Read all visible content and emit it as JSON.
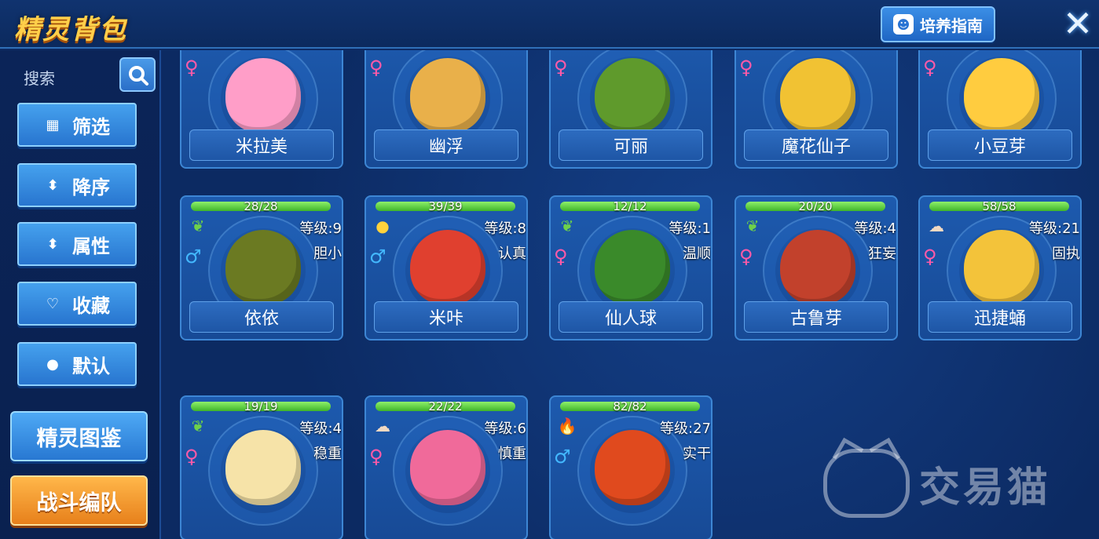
{
  "header": {
    "title": "精灵背包",
    "guide_label": "培养指南",
    "close_glyph": "✕"
  },
  "sidebar": {
    "search_label": "搜索",
    "buttons": [
      {
        "label": "筛选",
        "icon": "grid-icon"
      },
      {
        "label": "降序",
        "icon": "sort-icon"
      },
      {
        "label": "属性",
        "icon": "attribute-icon"
      },
      {
        "label": "收藏",
        "icon": "heart-icon"
      },
      {
        "label": "默认",
        "icon": "default-icon"
      }
    ],
    "dex_label": "精灵图鉴",
    "team_label": "战斗编队"
  },
  "pets": [
    {
      "name": "米拉美",
      "gender": "♀",
      "color": "#ff9ec8"
    },
    {
      "name": "幽浮",
      "gender": "♀",
      "color": "#e9b04a"
    },
    {
      "name": "可丽",
      "gender": "♀",
      "color": "#5f9a2c"
    },
    {
      "name": "魔花仙子",
      "gender": "♀",
      "color": "#f1c233"
    },
    {
      "name": "小豆芽",
      "gender": "♀",
      "color": "#ffcc3f"
    },
    {
      "name": "依依",
      "gender": "♂",
      "color": "#6b7a22",
      "hp": "28/28",
      "hp_ratio": 1.0,
      "level": "等级:9",
      "nature": "胆小",
      "attr": "grass"
    },
    {
      "name": "米咔",
      "gender": "♂",
      "color": "#e0402f",
      "hp": "39/39",
      "hp_ratio": 1.0,
      "level": "等级:8",
      "nature": "认真",
      "attr": "electric"
    },
    {
      "name": "仙人球",
      "gender": "♀",
      "color": "#3a8a2a",
      "hp": "12/12",
      "hp_ratio": 1.0,
      "level": "等级:1",
      "nature": "温顺",
      "attr": "grass"
    },
    {
      "name": "古鲁芽",
      "gender": "♀",
      "color": "#c2412c",
      "hp": "20/20",
      "hp_ratio": 1.0,
      "level": "等级:4",
      "nature": "狂妄",
      "attr": "grass"
    },
    {
      "name": "迅捷蛹",
      "gender": "♀",
      "color": "#f3c33a",
      "hp": "58/58",
      "hp_ratio": 1.0,
      "level": "等级:21",
      "nature": "固执",
      "attr": "wind"
    },
    {
      "name": "",
      "gender": "♀",
      "color": "#f6e3a8",
      "hp": "19/19",
      "hp_ratio": 1.0,
      "level": "等级:4",
      "nature": "稳重",
      "attr": "grass"
    },
    {
      "name": "",
      "gender": "♀",
      "color": "#f06a9a",
      "hp": "22/22",
      "hp_ratio": 1.0,
      "level": "等级:6",
      "nature": "慎重",
      "attr": "wind"
    },
    {
      "name": "",
      "gender": "♂",
      "color": "#e04a1e",
      "hp": "82/82",
      "hp_ratio": 1.0,
      "level": "等级:27",
      "nature": "实干",
      "attr": "fire"
    }
  ],
  "watermark": "交易猫"
}
